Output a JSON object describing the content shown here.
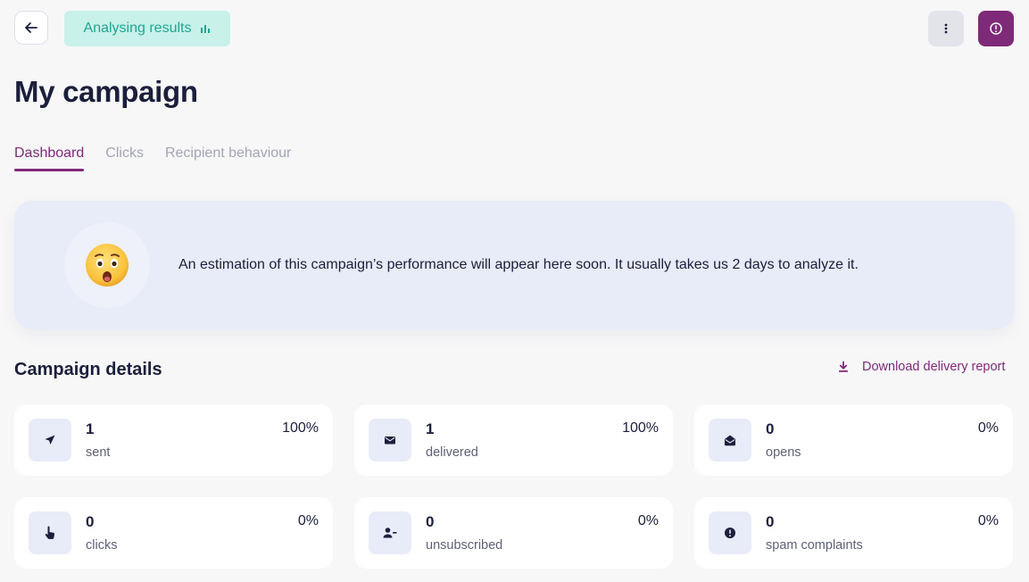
{
  "header": {
    "status_label": "Analysing results",
    "status_bg": "#c8f1ea",
    "status_color": "#1fa791",
    "back_icon": "arrow-left-icon",
    "more_icon": "more-vertical-icon",
    "info_icon": "info-icon",
    "accent": "#7e2a79"
  },
  "page": {
    "title": "My campaign"
  },
  "tabs": [
    {
      "label": "Dashboard",
      "active": true
    },
    {
      "label": "Clicks",
      "active": false
    },
    {
      "label": "Recipient behaviour",
      "active": false
    }
  ],
  "banner": {
    "emoji": "😲",
    "text": "An estimation of this campaign’s performance will appear here soon. It usually takes us 2 days to analyze it."
  },
  "details": {
    "title": "Campaign details",
    "download_label": "Download delivery report",
    "download_icon": "download-icon"
  },
  "stats": [
    {
      "value": "1",
      "label": "sent",
      "percent": "100%",
      "icon": "send-icon"
    },
    {
      "value": "1",
      "label": "delivered",
      "percent": "100%",
      "icon": "envelope-icon"
    },
    {
      "value": "0",
      "label": "opens",
      "percent": "0%",
      "icon": "envelope-open-icon"
    },
    {
      "value": "0",
      "label": "clicks",
      "percent": "0%",
      "icon": "pointer-hand-icon"
    },
    {
      "value": "0",
      "label": "unsubscribed",
      "percent": "0%",
      "icon": "user-minus-icon"
    },
    {
      "value": "0",
      "label": "spam complaints",
      "percent": "0%",
      "icon": "alert-circle-icon"
    }
  ]
}
